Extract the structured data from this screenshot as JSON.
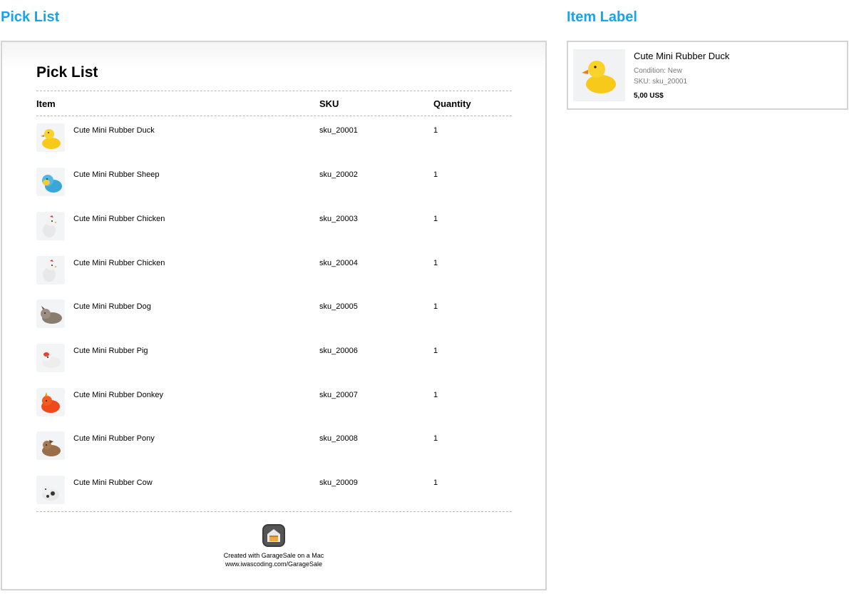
{
  "sections": {
    "pick_list_heading": "Pick List",
    "item_label_heading": "Item Label"
  },
  "pick_list": {
    "title": "Pick List",
    "columns": {
      "item": "Item",
      "sku": "SKU",
      "quantity": "Quantity"
    },
    "rows": [
      {
        "name": "Cute Mini Rubber Duck",
        "sku": "sku_20001",
        "quantity": "1",
        "icon": "duck-thumbnail"
      },
      {
        "name": "Cute Mini Rubber Sheep",
        "sku": "sku_20002",
        "quantity": "1",
        "icon": "sheep-thumbnail"
      },
      {
        "name": "Cute Mini Rubber Chicken",
        "sku": "sku_20003",
        "quantity": "1",
        "icon": "chicken-thumbnail"
      },
      {
        "name": "Cute Mini Rubber Chicken",
        "sku": "sku_20004",
        "quantity": "1",
        "icon": "chicken-thumbnail"
      },
      {
        "name": "Cute Mini Rubber Dog",
        "sku": "sku_20005",
        "quantity": "1",
        "icon": "dog-thumbnail"
      },
      {
        "name": "Cute Mini Rubber Pig",
        "sku": "sku_20006",
        "quantity": "1",
        "icon": "pig-thumbnail"
      },
      {
        "name": "Cute Mini Rubber Donkey",
        "sku": "sku_20007",
        "quantity": "1",
        "icon": "donkey-thumbnail"
      },
      {
        "name": "Cute Mini Rubber Pony",
        "sku": "sku_20008",
        "quantity": "1",
        "icon": "pony-thumbnail"
      },
      {
        "name": "Cute Mini Rubber Cow",
        "sku": "sku_20009",
        "quantity": "1",
        "icon": "cow-thumbnail"
      }
    ],
    "footer": {
      "line1": "Created with GarageSale on a Mac",
      "line2": "www.iwascoding.com/GarageSale",
      "icon": "garagesale-logo-icon"
    }
  },
  "item_label": {
    "title": "Cute Mini Rubber Duck",
    "condition": "Condition: New",
    "sku": "SKU: sku_20001",
    "price": "5,00 US$",
    "icon": "duck-thumbnail"
  },
  "colors": {
    "heading": "#1aa3e8",
    "border": "#d4d4d4",
    "rule": "#b8b8b8"
  }
}
